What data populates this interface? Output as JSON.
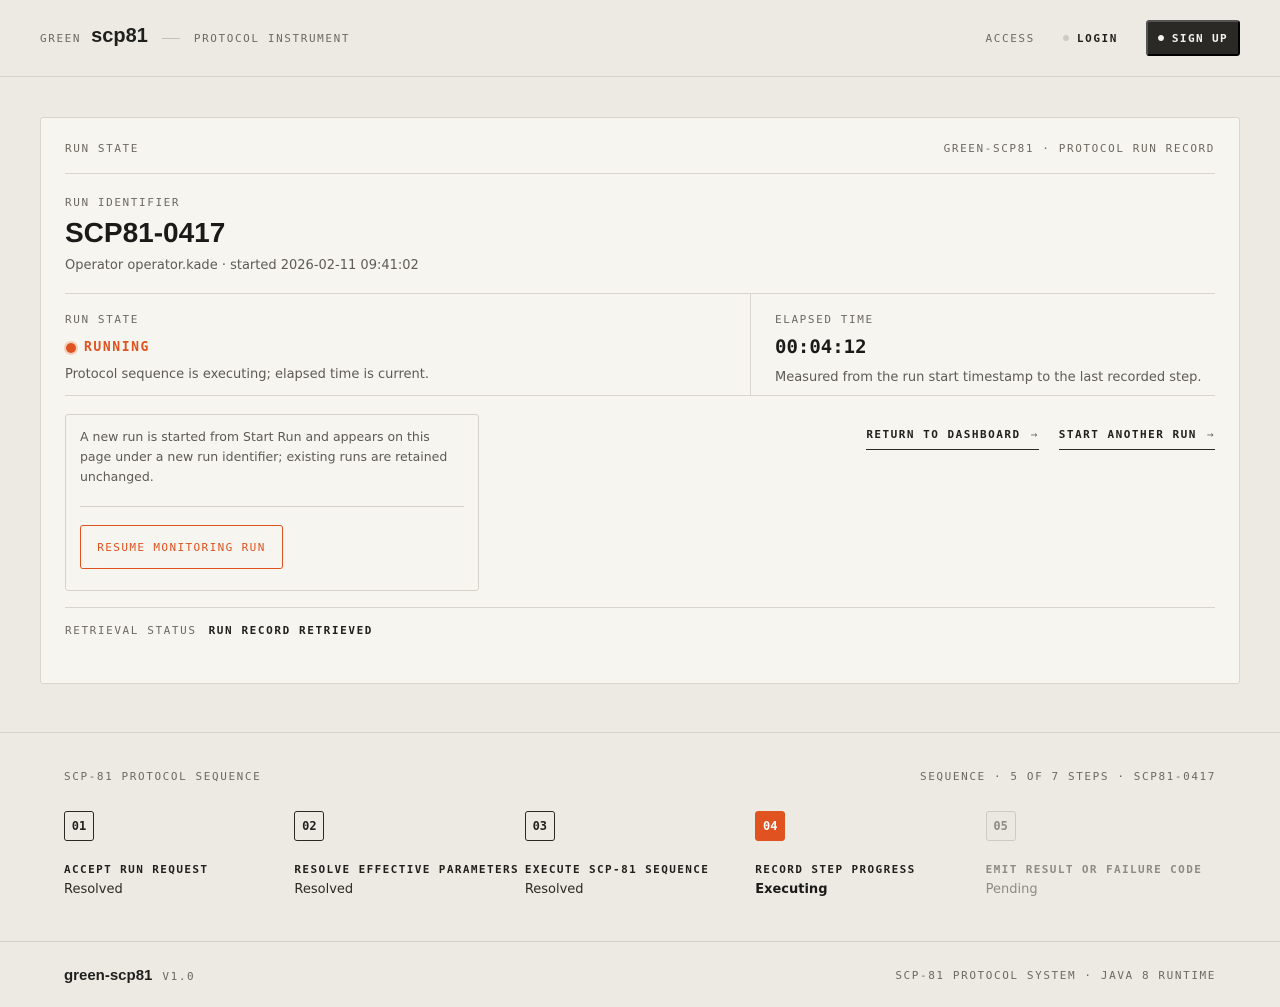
{
  "header": {
    "brand_prefix": "GREEN",
    "brand_name": "scp81",
    "subtitle": "PROTOCOL INSTRUMENT",
    "access_label": "ACCESS",
    "login_label": "LOGIN",
    "signup_label": "SIGN UP"
  },
  "card": {
    "heading": "RUN STATE",
    "record_label": "GREEN-SCP81 · PROTOCOL RUN RECORD",
    "run_identifier_label": "RUN IDENTIFIER",
    "run_identifier": "SCP81-0417",
    "run_meta": "Operator operator.kade · started 2026-02-11 09:41:02",
    "state": {
      "label": "RUN STATE",
      "value": "RUNNING",
      "description": "Protocol sequence is executing; elapsed time is current.",
      "color": "#e0521f"
    },
    "elapsed": {
      "label": "ELAPSED TIME",
      "value": "00:04:12",
      "description": "Measured from the run start timestamp to the last recorded step."
    },
    "notice": "A new run is started from Start Run and appears on this page under a new run identifier; existing runs are retained unchanged.",
    "resume_label": "RESUME MONITORING RUN",
    "links": {
      "dashboard": "RETURN TO DASHBOARD",
      "another": "START ANOTHER RUN",
      "arrow": "→"
    },
    "retrieval": {
      "label": "RETRIEVAL STATUS",
      "value": "RUN RECORD RETRIEVED"
    }
  },
  "sequence": {
    "title": "SCP-81 PROTOCOL SEQUENCE",
    "summary": "SEQUENCE · 5 OF 7 STEPS · SCP81-0417",
    "steps": [
      {
        "num": "01",
        "title": "ACCEPT RUN REQUEST",
        "status": "Resolved"
      },
      {
        "num": "02",
        "title": "RESOLVE EFFECTIVE PARAMETERS",
        "status": "Resolved"
      },
      {
        "num": "03",
        "title": "EXECUTE SCP-81 SEQUENCE",
        "status": "Resolved"
      },
      {
        "num": "04",
        "title": "RECORD STEP PROGRESS",
        "status": "Executing"
      },
      {
        "num": "05",
        "title": "EMIT RESULT OR FAILURE CODE",
        "status": "Pending"
      }
    ]
  },
  "footer": {
    "name": "green-scp81",
    "version": "V1.0",
    "system": "SCP-81 PROTOCOL SYSTEM · JAVA 8 RUNTIME"
  }
}
